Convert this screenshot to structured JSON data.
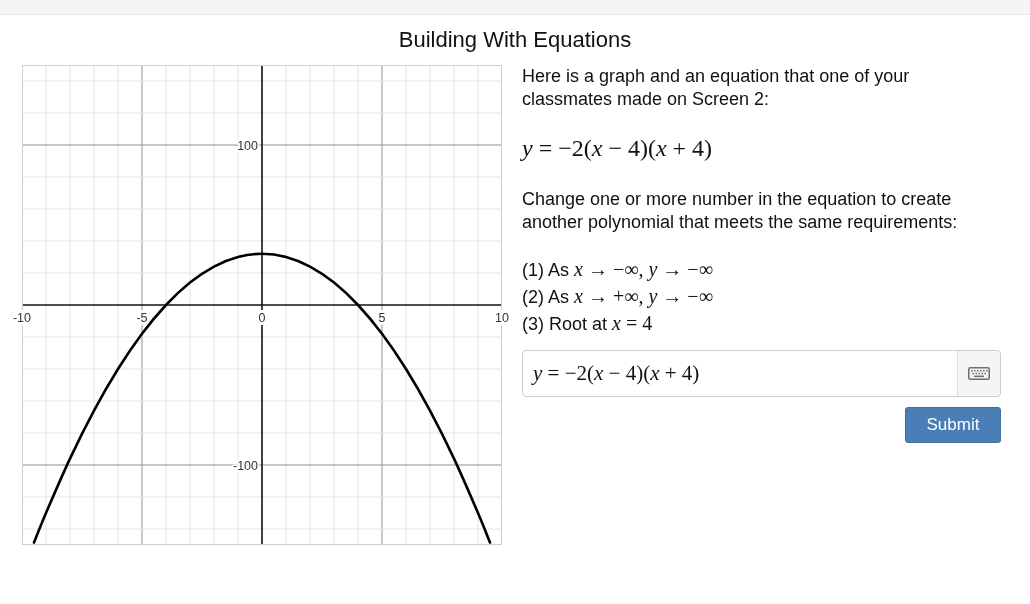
{
  "title": "Building With Equations",
  "graph": {
    "chart_data": [
      {
        "type": "line",
        "x": [
          -9.5,
          -9,
          -8,
          -7,
          -6,
          -5,
          -4,
          -3,
          -2,
          -1,
          0,
          1,
          2,
          3,
          4,
          5,
          6,
          7,
          8,
          9,
          9.5
        ],
        "values": [
          -148.5,
          -130,
          -96,
          -66,
          -40,
          -18,
          0,
          14,
          24,
          30,
          32,
          30,
          24,
          14,
          0,
          -18,
          -40,
          -66,
          -96,
          -130,
          -148.5
        ],
        "color": "#000000",
        "xlim": [
          -10,
          10
        ],
        "ylim": [
          -150,
          150
        ],
        "xticks": [
          -10,
          -5,
          0,
          5,
          10
        ],
        "yticks": [
          -100,
          100
        ],
        "grid": true
      }
    ]
  },
  "prompt": {
    "intro": "Here is a graph and an equation that one of your classmates made on Screen 2:",
    "equation": "*y* = −2(*x* − 4)(*x* + 4)",
    "instruction": "Change one or more number in the equation to create another polynomial that meets the same requirements:",
    "requirements": [
      {
        "text": "(1) As",
        "math": "*x* → −∞, *y* → −∞"
      },
      {
        "text": "(2) As",
        "math": "*x* → +∞, *y* → −∞"
      },
      {
        "text": "(3) Root at",
        "math": "*x* = 4"
      }
    ]
  },
  "answer": {
    "value": "*y* = −2(*x* − 4)(*x* + 4)"
  },
  "submit_button": {
    "label": "Submit"
  }
}
